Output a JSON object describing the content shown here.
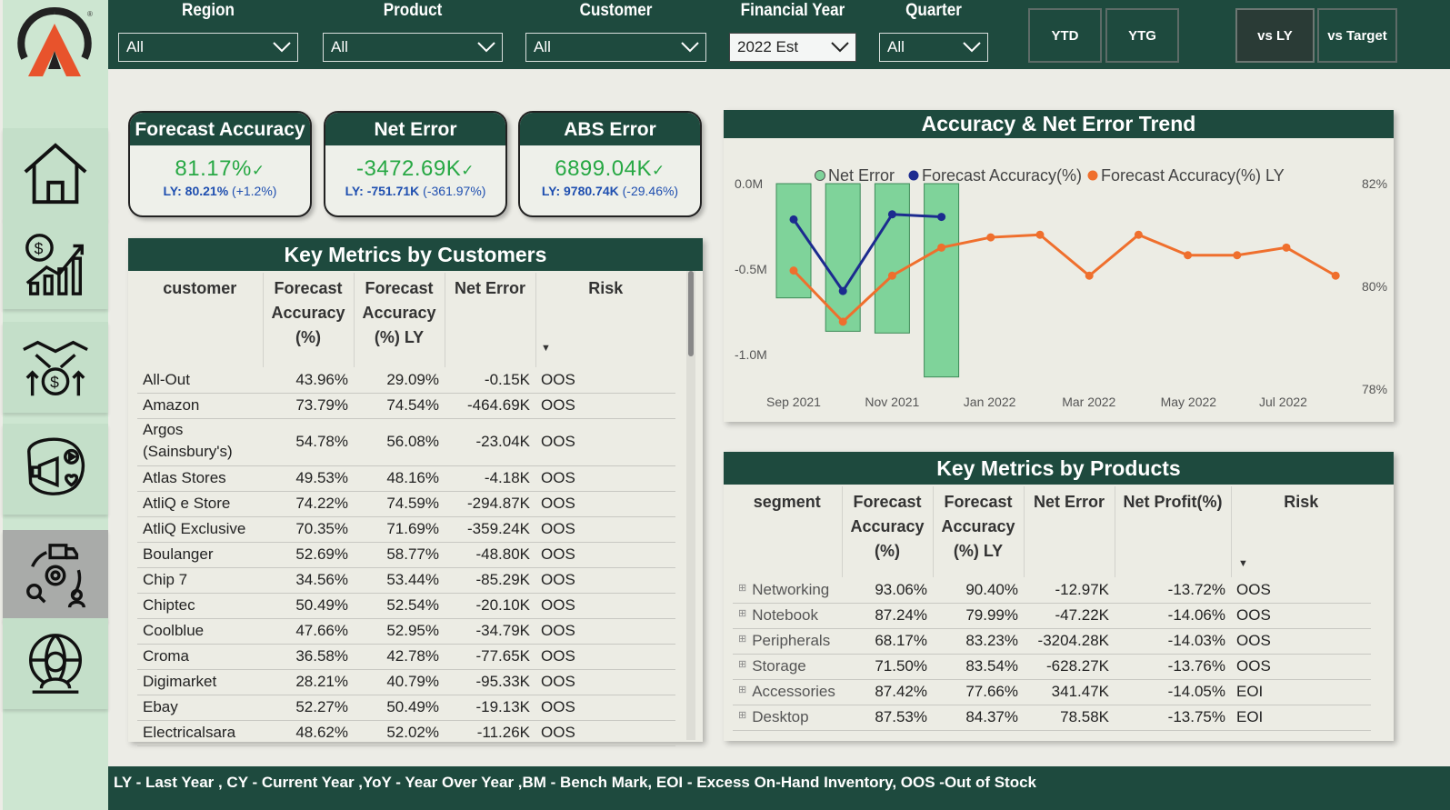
{
  "filters": [
    {
      "label": "Region",
      "value": "All"
    },
    {
      "label": "Product",
      "value": "All"
    },
    {
      "label": "Customer",
      "value": "All"
    },
    {
      "label": "Financial Year",
      "value": "2022 Est"
    },
    {
      "label": "Quarter",
      "value": "All"
    }
  ],
  "buttons": {
    "ytd": "YTD",
    "ytg": "YTG",
    "vs_ly": "vs LY",
    "vs_target": "vs Target"
  },
  "kpis": [
    {
      "title": "Forecast Accuracy",
      "value": "81.17%",
      "tick": "✓",
      "ly_label": "LY:",
      "ly_value": "80.21%",
      "ly_change": "(+1.2%)"
    },
    {
      "title": "Net Error",
      "value": "-3472.69K",
      "tick": "✓",
      "ly_label": "LY:",
      "ly_value": "-751.71K",
      "ly_change": "(-361.97%)"
    },
    {
      "title": "ABS Error",
      "value": "6899.04K",
      "tick": "✓",
      "ly_label": "LY:",
      "ly_value": "9780.74K",
      "ly_change": "(-29.46%)"
    }
  ],
  "customers_table": {
    "title": "Key Metrics by Customers",
    "headers": [
      "customer",
      "Forecast Accuracy (%)",
      "Forecast Accuracy (%) LY",
      "Net Error",
      "Risk"
    ],
    "sort_indicator": "▼",
    "rows": [
      [
        "All-Out",
        "43.96%",
        "29.09%",
        "-0.15K",
        "OOS"
      ],
      [
        "Amazon",
        "73.79%",
        "74.54%",
        "-464.69K",
        "OOS"
      ],
      [
        "Argos (Sainsbury's)",
        "54.78%",
        "56.08%",
        "-23.04K",
        "OOS"
      ],
      [
        "Atlas Stores",
        "49.53%",
        "48.16%",
        "-4.18K",
        "OOS"
      ],
      [
        "AtliQ e Store",
        "74.22%",
        "74.59%",
        "-294.87K",
        "OOS"
      ],
      [
        "AtliQ Exclusive",
        "70.35%",
        "71.69%",
        "-359.24K",
        "OOS"
      ],
      [
        "Boulanger",
        "52.69%",
        "58.77%",
        "-48.80K",
        "OOS"
      ],
      [
        "Chip 7",
        "34.56%",
        "53.44%",
        "-85.29K",
        "OOS"
      ],
      [
        "Chiptec",
        "50.49%",
        "52.54%",
        "-20.10K",
        "OOS"
      ],
      [
        "Coolblue",
        "47.66%",
        "52.95%",
        "-34.79K",
        "OOS"
      ],
      [
        "Croma",
        "36.58%",
        "42.78%",
        "-77.65K",
        "OOS"
      ],
      [
        "Digimarket",
        "28.21%",
        "40.79%",
        "-95.33K",
        "OOS"
      ],
      [
        "Ebay",
        "52.27%",
        "50.49%",
        "-19.13K",
        "OOS"
      ],
      [
        "Electricalsara",
        "48.62%",
        "52.02%",
        "-11.26K",
        "OOS"
      ]
    ]
  },
  "products_table": {
    "title": "Key Metrics by Products",
    "headers": [
      "segment",
      "Forecast Accuracy (%)",
      "Forecast Accuracy (%) LY",
      "Net Error",
      "Net Profit(%)",
      "Risk"
    ],
    "sort_indicator": "▼",
    "expand_icon": "⊞",
    "rows": [
      [
        "Networking",
        "93.06%",
        "90.40%",
        "-12.97K",
        "-13.72%",
        "OOS"
      ],
      [
        "Notebook",
        "87.24%",
        "79.99%",
        "-47.22K",
        "-14.06%",
        "OOS"
      ],
      [
        "Peripherals",
        "68.17%",
        "83.23%",
        "-3204.28K",
        "-14.03%",
        "OOS"
      ],
      [
        "Storage",
        "71.50%",
        "83.54%",
        "-628.27K",
        "-13.76%",
        "OOS"
      ],
      [
        "Accessories",
        "87.42%",
        "77.66%",
        "341.47K",
        "-14.05%",
        "EOI"
      ],
      [
        "Desktop",
        "87.53%",
        "84.37%",
        "78.58K",
        "-13.75%",
        "EOI"
      ]
    ]
  },
  "chart_panel_title": "Accuracy & Net Error Trend",
  "chart_data": {
    "type": "bar",
    "title": "Accuracy & Net Error Trend",
    "x_labels": [
      "Sep 2021",
      "Nov 2021",
      "Jan 2022",
      "Mar 2022",
      "May 2022",
      "Jul 2022"
    ],
    "months": [
      "Sep 2021",
      "Oct 2021",
      "Nov 2021",
      "Dec 2021",
      "Jan 2022",
      "Feb 2022",
      "Mar 2022",
      "Apr 2022",
      "May 2022",
      "Jun 2022",
      "Jul 2022",
      "Aug 2022"
    ],
    "left_axis": {
      "ticks": [
        "0.0M",
        "-0.5M",
        "-1.0M"
      ],
      "range": [
        -1.2,
        0.0
      ]
    },
    "right_axis": {
      "ticks": [
        "82%",
        "80%",
        "78%"
      ],
      "range": [
        78,
        82
      ]
    },
    "legend_position": "top",
    "series": [
      {
        "name": "Net Error",
        "kind": "bar",
        "axis": "left",
        "color": "#7fd39a",
        "values": [
          -0.65,
          null,
          -0.84,
          null,
          -0.85,
          null,
          -1.1,
          null,
          null,
          null,
          null,
          null
        ],
        "bar_months": [
          "Sep 2021",
          "Oct 2021",
          "Nov 2021",
          "Dec 2021"
        ],
        "bar_values": [
          -0.65,
          -0.84,
          -0.85,
          -1.1
        ]
      },
      {
        "name": "Forecast Accuracy(%)",
        "kind": "line",
        "axis": "right",
        "color": "#1c2b8f",
        "points": [
          [
            "Sep 2021",
            81.3
          ],
          [
            "Oct 2021",
            79.9
          ],
          [
            "Nov 2021",
            81.4
          ],
          [
            "Dec 2021",
            81.35
          ]
        ]
      },
      {
        "name": "Forecast Accuracy(%) LY",
        "kind": "line",
        "axis": "right",
        "color": "#ef6f2d",
        "points": [
          [
            "Sep 2021",
            80.3
          ],
          [
            "Oct 2021",
            79.3
          ],
          [
            "Nov 2021",
            80.2
          ],
          [
            "Dec 2021",
            80.75
          ],
          [
            "Jan 2022",
            80.95
          ],
          [
            "Feb 2022",
            81.0
          ],
          [
            "Mar 2022",
            80.2
          ],
          [
            "Apr 2022",
            81.0
          ],
          [
            "May 2022",
            80.6
          ],
          [
            "Jun 2022",
            80.6
          ],
          [
            "Jul 2022",
            80.75
          ],
          [
            "Aug 2022",
            80.2
          ]
        ]
      }
    ]
  },
  "footer": "LY - Last Year , CY - Current Year ,YoY - Year Over Year ,BM - Bench Mark, EOI - Excess On-Hand Inventory, OOS -Out of Stock",
  "colors": {
    "header_green": "#1e4a3e",
    "sidebar": "#cde6d1",
    "positive": "#27a844",
    "ly_blue": "#1f4fb0"
  },
  "icons": [
    "logo-a-icon",
    "home-icon",
    "finance-growth-icon",
    "handshake-money-icon",
    "marketing-megaphone-icon",
    "supply-chain-icon",
    "global-executive-icon",
    "chevron-down-icon",
    "sort-down-icon",
    "expand-icon"
  ]
}
